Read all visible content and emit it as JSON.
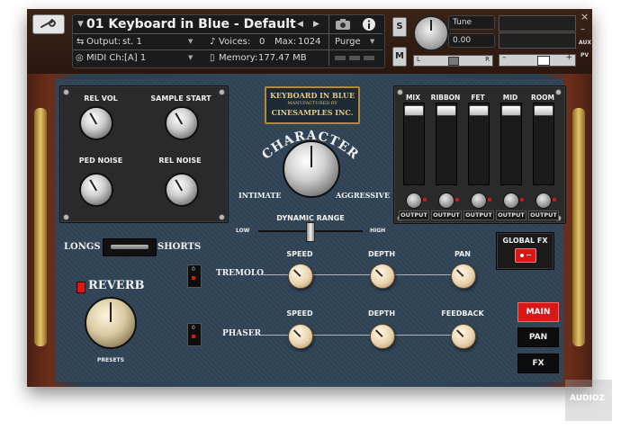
{
  "header": {
    "instrument_name": "01 Keyboard in Blue - Default",
    "output_label": "Output:",
    "output_value": "st. 1",
    "voices_label": "Voices:",
    "voices_value": "0",
    "max_label": "Max:",
    "max_value": "1024",
    "purge_label": "Purge",
    "midi_label": "MIDI Ch:",
    "midi_value": "[A]  1",
    "memory_label": "Memory:",
    "memory_value": "177.47 MB",
    "solo_label": "S",
    "mute_label": "M",
    "tune_label": "Tune",
    "tune_value": "0.00",
    "pan_left": "L",
    "pan_right": "R",
    "aux_label": "AUX",
    "pv_label": "PV",
    "close_label": "×",
    "minimize_label": "–",
    "vol_minus": "–",
    "vol_plus": "+"
  },
  "left_panel": {
    "rel_vol": "REL VOL",
    "sample_start": "SAMPLE START",
    "ped_noise": "PED NOISE",
    "rel_noise": "REL NOISE"
  },
  "badge": {
    "line1": "KEYBOARD IN BLUE",
    "line2": "MANUFACTURED BY",
    "line3": "CINESAMPLES INC."
  },
  "character": {
    "title": "CHARACTER",
    "left": "INTIMATE",
    "right": "AGGRESSIVE"
  },
  "dynamic_range": {
    "title": "DYNAMIC RANGE",
    "low": "LOW",
    "high": "HIGH"
  },
  "mixer": {
    "channels": [
      "MIX",
      "RIBBON",
      "FET",
      "MID",
      "ROOM"
    ],
    "output_label": "OUTPUT"
  },
  "longs_shorts": {
    "left": "LONGS",
    "right": "SHORTS"
  },
  "global_fx": "GLOBAL FX",
  "reverb": {
    "title": "REVERB",
    "presets": "PRESETS"
  },
  "tremolo": {
    "title": "TREMOLO",
    "speed": "SPEED",
    "depth": "DEPTH",
    "pan": "PAN"
  },
  "phaser": {
    "title": "PHASER",
    "speed": "SPEED",
    "depth": "DEPTH",
    "feedback": "FEEDBACK"
  },
  "fx_switch": {
    "on": "0",
    "off": "I"
  },
  "nav": {
    "main": "MAIN",
    "pan": "PAN",
    "fx": "FX"
  },
  "watermark": "AUDIOZ",
  "colors": {
    "accent_red": "#d81818",
    "panel_blue": "#2f4456",
    "wood": "#6b2e1a"
  }
}
